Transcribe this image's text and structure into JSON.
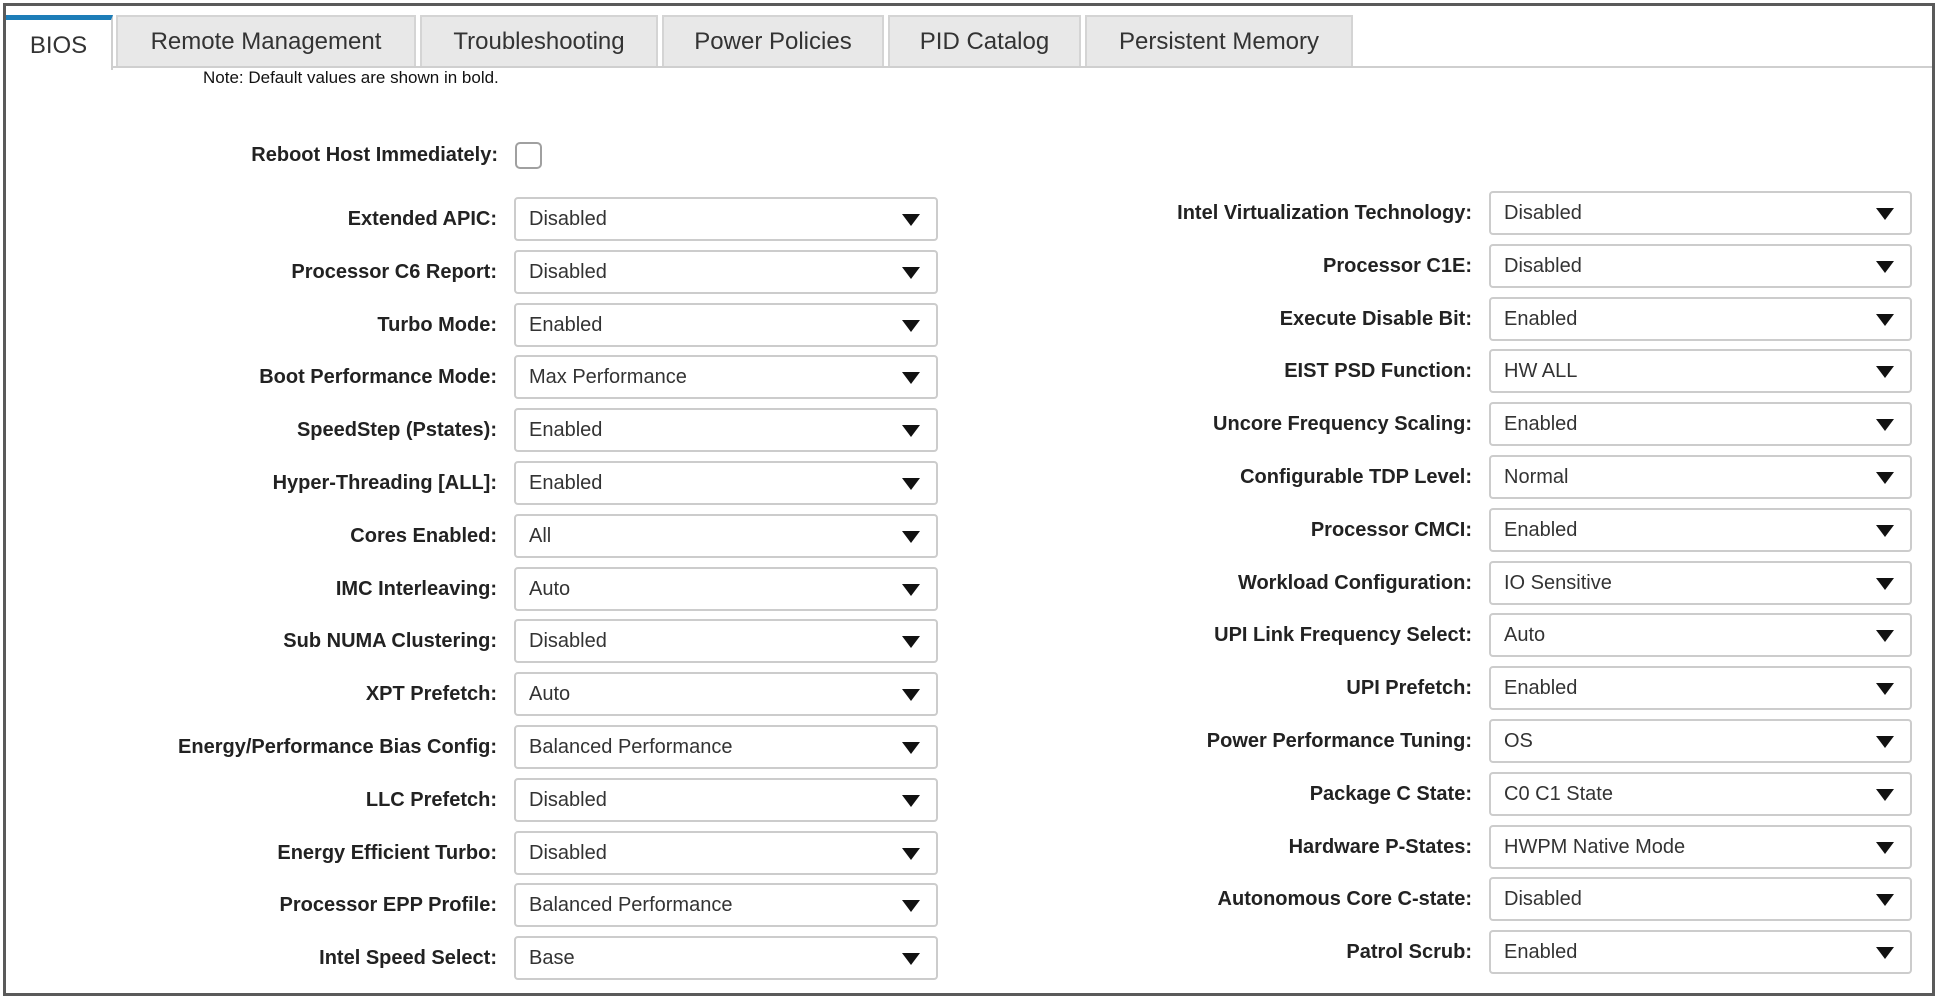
{
  "tabs": [
    {
      "label": "BIOS",
      "active": true
    },
    {
      "label": "Remote Management",
      "active": false
    },
    {
      "label": "Troubleshooting",
      "active": false
    },
    {
      "label": "Power Policies",
      "active": false
    },
    {
      "label": "PID Catalog",
      "active": false
    },
    {
      "label": "Persistent Memory",
      "active": false
    }
  ],
  "note": "Note: Default values are shown in bold.",
  "reboot": {
    "label": "Reboot Host Immediately:",
    "checked": false
  },
  "left_settings": [
    {
      "label": "Extended APIC:",
      "value": "Disabled"
    },
    {
      "label": "Processor C6 Report:",
      "value": "Disabled"
    },
    {
      "label": "Turbo Mode:",
      "value": "Enabled"
    },
    {
      "label": "Boot Performance Mode:",
      "value": "Max Performance"
    },
    {
      "label": "SpeedStep (Pstates):",
      "value": "Enabled"
    },
    {
      "label": "Hyper-Threading [ALL]:",
      "value": "Enabled"
    },
    {
      "label": "Cores Enabled:",
      "value": "All"
    },
    {
      "label": "IMC Interleaving:",
      "value": "Auto"
    },
    {
      "label": "Sub NUMA Clustering:",
      "value": "Disabled"
    },
    {
      "label": "XPT Prefetch:",
      "value": "Auto"
    },
    {
      "label": "Energy/Performance Bias Config:",
      "value": "Balanced Performance"
    },
    {
      "label": "LLC Prefetch:",
      "value": "Disabled"
    },
    {
      "label": "Energy Efficient Turbo:",
      "value": "Disabled"
    },
    {
      "label": "Processor EPP Profile:",
      "value": "Balanced Performance"
    },
    {
      "label": "Intel Speed Select:",
      "value": "Base"
    }
  ],
  "right_settings": [
    {
      "label": "Intel Virtualization Technology:",
      "value": "Disabled"
    },
    {
      "label": "Processor C1E:",
      "value": "Disabled"
    },
    {
      "label": "Execute Disable Bit:",
      "value": "Enabled"
    },
    {
      "label": "EIST PSD Function:",
      "value": "HW ALL"
    },
    {
      "label": "Uncore Frequency Scaling:",
      "value": "Enabled"
    },
    {
      "label": "Configurable TDP Level:",
      "value": "Normal"
    },
    {
      "label": "Processor CMCI:",
      "value": "Enabled"
    },
    {
      "label": "Workload Configuration:",
      "value": "IO Sensitive"
    },
    {
      "label": "UPI Link Frequency Select:",
      "value": "Auto"
    },
    {
      "label": "UPI Prefetch:",
      "value": "Enabled"
    },
    {
      "label": "Power Performance Tuning:",
      "value": "OS"
    },
    {
      "label": "Package C State:",
      "value": "C0 C1 State"
    },
    {
      "label": "Hardware P-States:",
      "value": "HWPM Native Mode"
    },
    {
      "label": "Autonomous Core C-state:",
      "value": "Disabled"
    },
    {
      "label": "Patrol Scrub:",
      "value": "Enabled"
    }
  ],
  "colors": {
    "active_tab_accent": "#1d7db8",
    "inactive_tab_bg": "#e8e8e8",
    "frame_border": "#5a5a5a"
  },
  "icons": {
    "dropdown": "caret-down-icon"
  }
}
